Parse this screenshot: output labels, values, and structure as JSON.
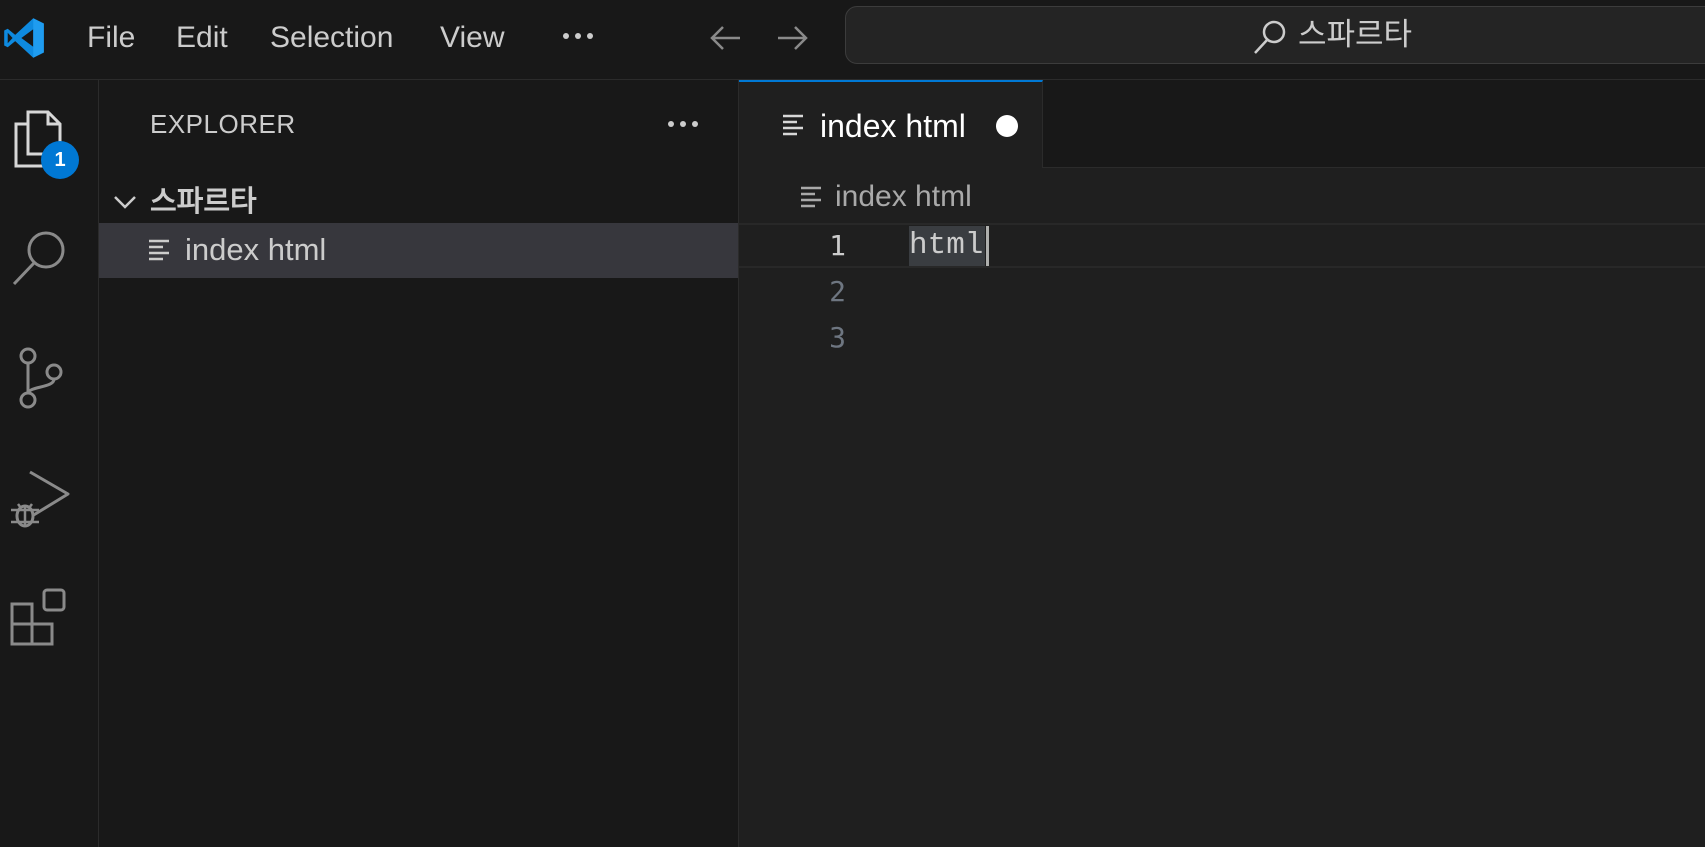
{
  "titlebar": {
    "logo_icon": "vscode-logo-icon",
    "menu": [
      "File",
      "Edit",
      "Selection",
      "View"
    ],
    "more_icon": "ellipsis-icon",
    "back_icon": "arrow-left-icon",
    "forward_icon": "arrow-right-icon",
    "search_text": "스파르타",
    "search_icon": "search-icon"
  },
  "activitybar": {
    "items": [
      "explorer-icon",
      "search-icon",
      "source-control-icon",
      "run-debug-icon",
      "extensions-icon"
    ],
    "explorer_badge": "1",
    "accent_color": "#0078d4"
  },
  "sidebar": {
    "title": "EXPLORER",
    "folder": "스파르타",
    "files": [
      {
        "name": "index html",
        "icon": "text-file-icon",
        "selected": true
      }
    ]
  },
  "editor": {
    "tab": {
      "name": "index html",
      "icon": "text-file-icon",
      "modified": true
    },
    "breadcrumb": "index html",
    "lines": [
      {
        "number": "1",
        "text": "html"
      },
      {
        "number": "2",
        "text": ""
      },
      {
        "number": "3",
        "text": ""
      }
    ]
  }
}
